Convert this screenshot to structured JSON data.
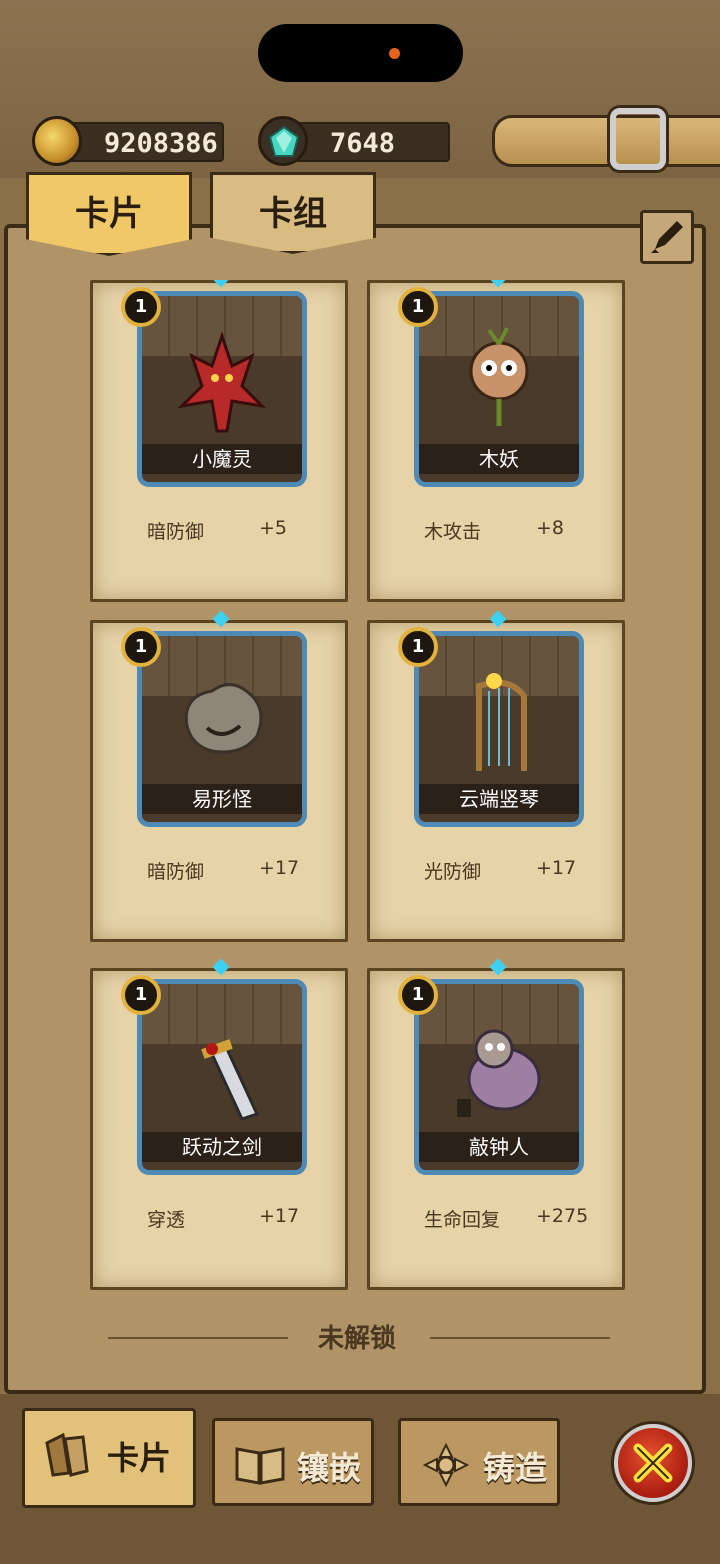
{
  "resources": {
    "gold": "9208386",
    "gems": "7648"
  },
  "tabs": [
    {
      "label": "卡片",
      "active": true
    },
    {
      "label": "卡组",
      "active": false
    }
  ],
  "cards": [
    {
      "level": "1",
      "name": "小魔灵",
      "stat_name": "暗防御",
      "stat_value": "+5"
    },
    {
      "level": "1",
      "name": "木妖",
      "stat_name": "木攻击",
      "stat_value": "+8"
    },
    {
      "level": "1",
      "name": "易形怪",
      "stat_name": "暗防御",
      "stat_value": "+17"
    },
    {
      "level": "1",
      "name": "云端竖琴",
      "stat_name": "光防御",
      "stat_value": "+17"
    },
    {
      "level": "1",
      "name": "跃动之剑",
      "stat_name": "穿透",
      "stat_value": "+17"
    },
    {
      "level": "1",
      "name": "敲钟人",
      "stat_name": "生命回复",
      "stat_value": "+275"
    }
  ],
  "unlock_section": {
    "label": "未解锁"
  },
  "bottom_nav": [
    {
      "label": "卡片",
      "icon": "cards-icon",
      "active": true
    },
    {
      "label": "镶嵌",
      "icon": "book-icon",
      "active": false
    },
    {
      "label": "铸造",
      "icon": "forge-icon",
      "active": false
    }
  ],
  "colors": {
    "accent_gold": "#e2b23c",
    "card_frame": "#4d8ab5",
    "close_red": "#c42a16"
  }
}
